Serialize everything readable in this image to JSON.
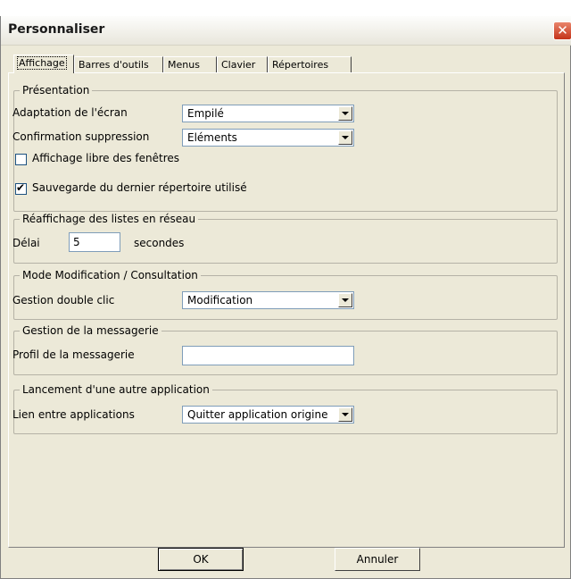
{
  "window": {
    "title": "Personnaliser",
    "close_glyph": "✕"
  },
  "tabs": [
    {
      "label": "Affichage",
      "active": true
    },
    {
      "label": "Barres d'outils"
    },
    {
      "label": "Menus"
    },
    {
      "label": "Clavier"
    },
    {
      "label": "Répertoires"
    }
  ],
  "presentation": {
    "legend": "Présentation",
    "adaptation_label": "Adaptation de l'écran",
    "adaptation_value": "Empilé",
    "confirmation_label": "Confirmation suppression",
    "confirmation_value": "Eléments",
    "affichage_libre_label": "Affichage libre des fenêtres",
    "affichage_libre_checked": false,
    "sauvegarde_label": "Sauvegarde du dernier répertoire utilisé",
    "sauvegarde_checked": true
  },
  "reaffichage": {
    "legend": "Réaffichage des listes en réseau",
    "delai_label": "Délai",
    "delai_value": "5",
    "unit": "secondes"
  },
  "mode": {
    "legend": "Mode Modification / Consultation",
    "gestion_label": "Gestion double clic",
    "gestion_value": "Modification"
  },
  "messagerie": {
    "legend": "Gestion de la messagerie",
    "profil_label": "Profil de la messagerie",
    "profil_value": ""
  },
  "lancement": {
    "legend": "Lancement d'une autre application",
    "lien_label": "Lien entre applications",
    "lien_value": "Quitter application origine"
  },
  "buttons": {
    "ok": "OK",
    "cancel": "Annuler"
  }
}
